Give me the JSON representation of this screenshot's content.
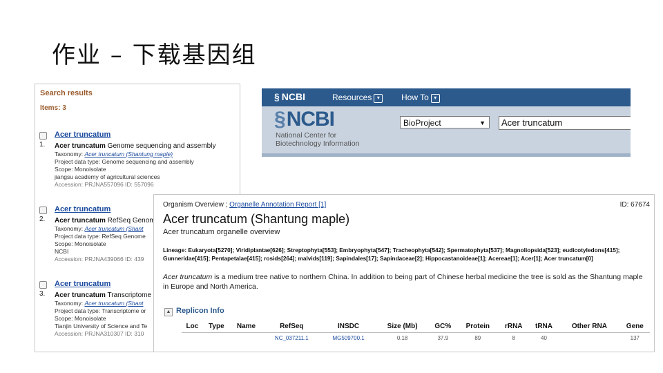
{
  "slide": {
    "title": "作业 – 下载基因组"
  },
  "search_results": {
    "heading": "Search results",
    "count": "Items: 3",
    "items": [
      {
        "num": "1.",
        "link": "Acer truncatum",
        "title_bold": "Acer truncatum",
        "title_rest": " Genome sequencing and assembly",
        "taxonomy_label": "Taxonomy: ",
        "taxonomy_link": "Acer truncatum (Shantung maple)",
        "data_type": "Project data type: Genome sequencing and assembly",
        "scope": "Scope: Monoisolate",
        "org": "jiangsu academy of agricultural sciences",
        "accession": "Accession: PRJNA557096   ID: 557096"
      },
      {
        "num": "2.",
        "link": "Acer truncatum",
        "title_bold": "Acer truncatum",
        "title_rest": " RefSeq Genome",
        "taxonomy_label": "Taxonomy: ",
        "taxonomy_link": "Acer truncatum (Shant",
        "data_type": "Project data type: RefSeq Genome",
        "scope": "Scope: Monoisolate",
        "org": "NCBI",
        "accession": "Accession: PRJNA439066   ID: 439"
      },
      {
        "num": "3.",
        "link": "Acer truncatum",
        "title_bold": "Acer truncatum",
        "title_rest": " Transcriptome",
        "taxonomy_label": "Taxonomy: ",
        "taxonomy_link": "Acer truncatum (Shant",
        "data_type": "Project data type: Transcriptome or",
        "scope": "Scope: Monoisolate",
        "org": "Tianjin University of Science and Te",
        "accession": "Accession: PRJNA310307   ID: 310"
      }
    ]
  },
  "ncbi": {
    "small_logo": "NCBI",
    "nav": {
      "resources": "Resources",
      "howto": "How To"
    },
    "logo": "NCBI",
    "subtitle_line1": "National Center for",
    "subtitle_line2": "Biotechnology Information",
    "database": "BioProject",
    "search_term": "Acer truncatum"
  },
  "organism": {
    "tab_overview": "Organism Overview",
    "tab_sep": " ; ",
    "tab_report": "Organelle Annotation Report [1]",
    "id": "ID: 67674",
    "title": "Acer truncatum (Shantung maple)",
    "subtitle": "Acer truncatum organelle overview",
    "lineage_label": "Lineage: ",
    "lineage": "Eukaryota[5270]; Viridiplantae[626]; Streptophyta[553]; Embryophyta[547]; Tracheophyta[542]; Spermatophyta[537]; Magnoliopsida[523]; eudicotyledons[415]; Gunneridae[415]; Pentapetalae[415]; rosids[264]; malvids[119]; Sapindales[17]; Sapindaceae[2]; Hippocastanoideae[1]; Acereae[1]; Acer[1]; Acer truncatum[0]",
    "desc_italic": "Acer truncatum",
    "desc_rest": " is a medium tree native to northern China. In addition to being part of Chinese herbal medicine the tree is sold as the Shantung maple in Europe and North America.",
    "replicon_heading": "Replicon Info",
    "table": {
      "headers": [
        "Loc",
        "Type",
        "Name",
        "RefSeq",
        "INSDC",
        "Size (Mb)",
        "GC%",
        "Protein",
        "rRNA",
        "tRNA",
        "Other RNA",
        "Gene"
      ],
      "row": [
        "",
        "",
        "",
        "NC_037211.1",
        "MG509700.1",
        "0.18",
        "37.9",
        "89",
        "8",
        "40",
        "",
        "137"
      ]
    }
  }
}
